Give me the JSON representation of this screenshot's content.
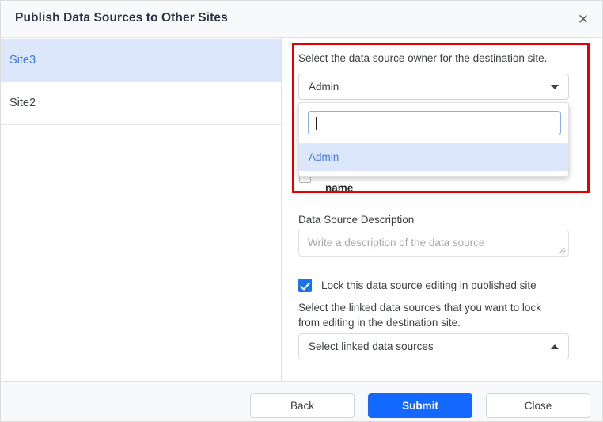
{
  "header": {
    "title": "Publish Data Sources to Other Sites",
    "close_icon": "close-icon",
    "close_glyph": "✕"
  },
  "sidebar": {
    "items": [
      {
        "label": "Site3",
        "selected": true
      },
      {
        "label": "Site2",
        "selected": false
      }
    ]
  },
  "pane": {
    "owner_label": "Select the data source owner for the destination site.",
    "owner_select": {
      "value": "Admin",
      "caret_icon": "chevron-down-icon"
    },
    "dropdown": {
      "search_value": "",
      "options": [
        {
          "label": "Admin",
          "highlighted": true
        }
      ]
    },
    "occluded_row": {
      "text": "name"
    },
    "description": {
      "label": "Data Source Description",
      "placeholder": "Write a description of the data source",
      "value": ""
    },
    "lock": {
      "checkbox_label": "Lock this data source editing in published site",
      "checked": true,
      "help_text": "Select the linked data sources that you want to lock from editing in the destination site.",
      "linked_select_value": "Select linked data sources",
      "linked_caret_icon": "chevron-up-icon"
    }
  },
  "footer": {
    "back_label": "Back",
    "submit_label": "Submit",
    "close_label": "Close"
  },
  "colors": {
    "accent_blue": "#1268ff",
    "selected_row": "#dce7fb",
    "link_blue": "#3b78e7",
    "highlight_red": "#e60000",
    "header_bg": "#f8f9fa"
  }
}
